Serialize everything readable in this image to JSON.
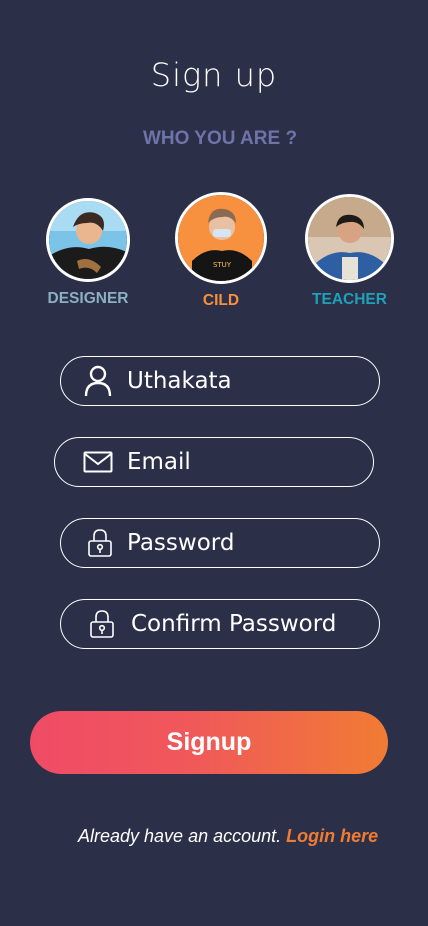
{
  "title": "Sign up",
  "subtitle": "WHO YOU ARE ?",
  "roles": [
    {
      "label": "DESIGNER",
      "color": "#8ab0c2"
    },
    {
      "label": "CILD",
      "color": "#f7903f"
    },
    {
      "label": "TEACHER",
      "color": "#21a0b8"
    }
  ],
  "form": {
    "username": {
      "value": "Uthakata",
      "icon": "user-icon"
    },
    "email": {
      "placeholder": "Email",
      "icon": "mail-icon"
    },
    "password": {
      "placeholder": "Password",
      "icon": "lock-icon"
    },
    "confirm_password": {
      "placeholder": "Confirm Password",
      "icon": "lock-icon"
    }
  },
  "signup_label": "Signup",
  "footer": {
    "text": "Already have an account.",
    "login_link": "Login here"
  },
  "colors": {
    "background": "#2b2f48",
    "accent": "#f07c33",
    "gradient_start": "#ef4b66",
    "subtitle": "#6e73a8"
  }
}
